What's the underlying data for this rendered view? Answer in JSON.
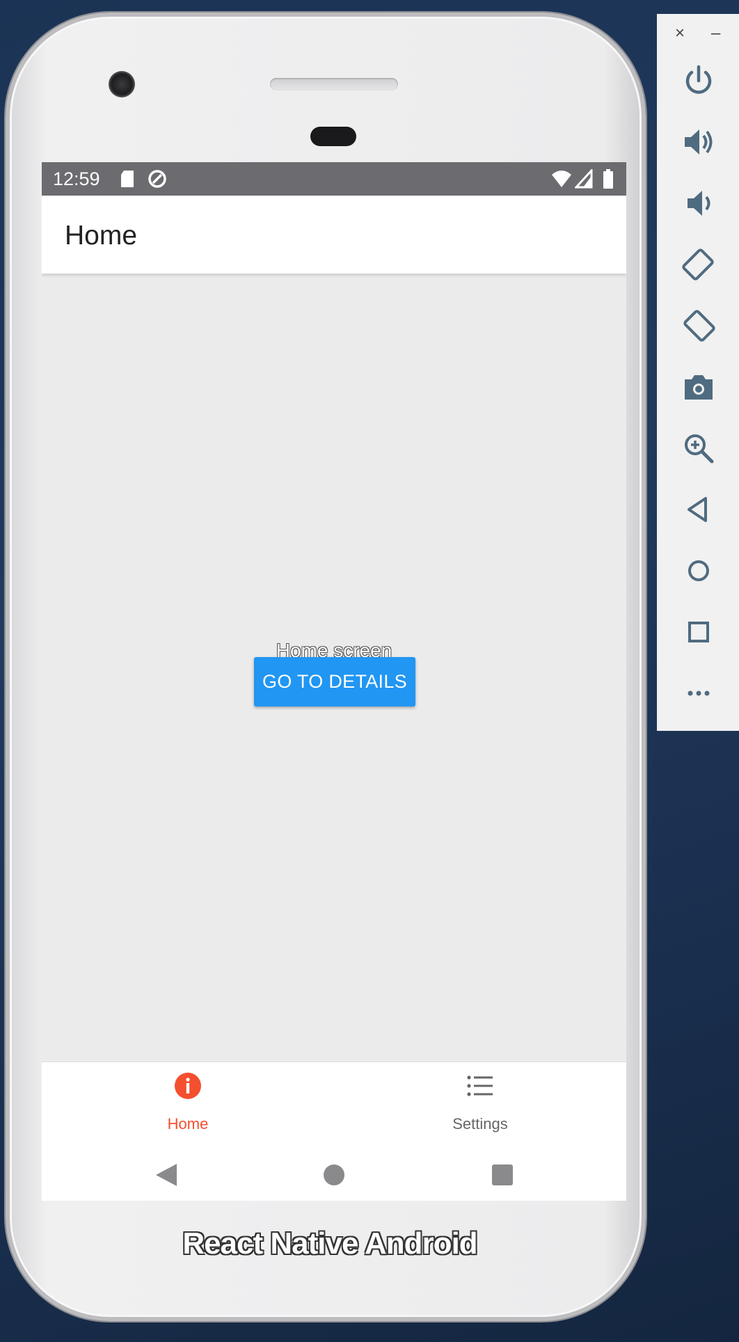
{
  "status_bar": {
    "time": "12:59"
  },
  "app_bar": {
    "title": "Home"
  },
  "content": {
    "text": "Home screen",
    "button_label": "GO TO DETAILS"
  },
  "tab_bar": {
    "active_color": "#f44f2e",
    "inactive_color": "#666666",
    "tabs": [
      {
        "label": "Home",
        "icon": "info-icon",
        "active": true
      },
      {
        "label": "Settings",
        "icon": "list-icon",
        "active": false
      }
    ]
  },
  "android_nav": [
    "back-icon",
    "home-circle-icon",
    "recents-square-icon"
  ],
  "device_label": "React Native Android",
  "emulator_panel": {
    "window_controls": [
      "×",
      "–"
    ],
    "tools": [
      "power-icon",
      "volume-up-icon",
      "volume-down-icon",
      "rotate-left-icon",
      "rotate-right-icon",
      "camera-icon",
      "zoom-icon",
      "back-icon",
      "home-icon",
      "overview-icon",
      "more-icon"
    ]
  },
  "colors": {
    "button": "#2196f3",
    "status_bar": "#6b6b70",
    "side_icons": "#4f6b80"
  }
}
